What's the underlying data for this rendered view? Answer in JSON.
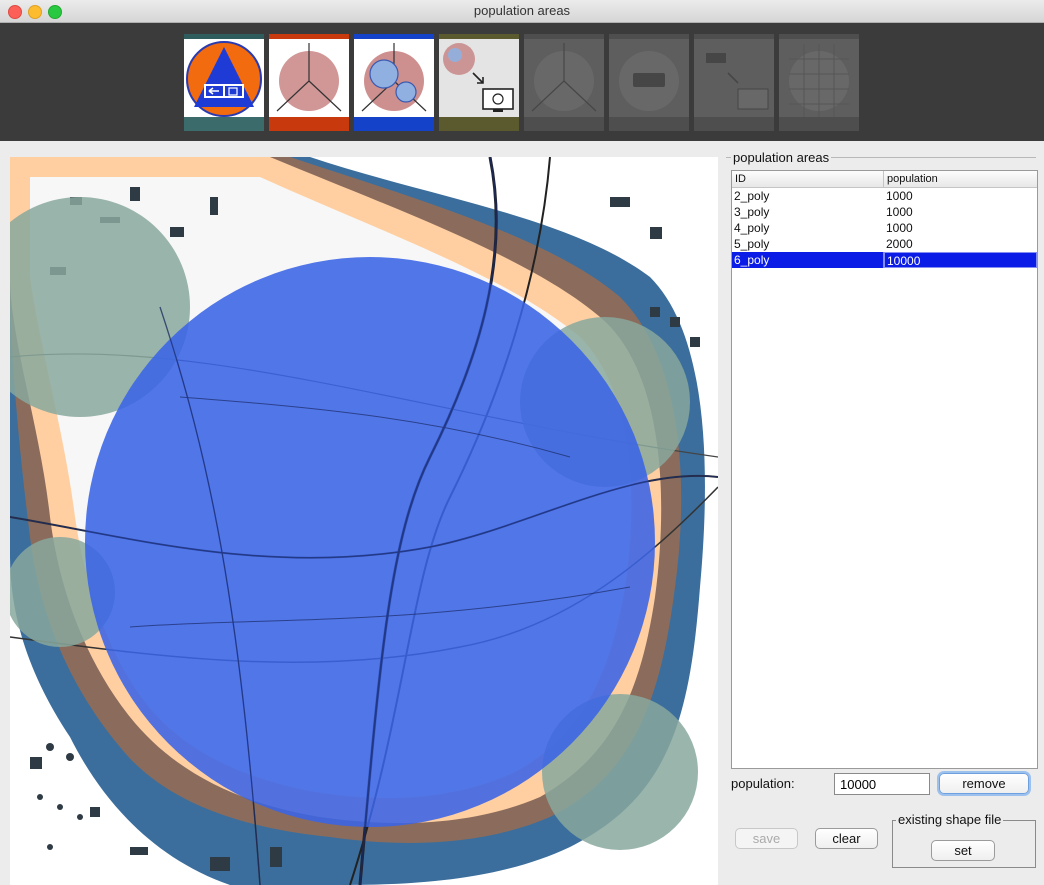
{
  "window": {
    "title": "population areas"
  },
  "toolbar": {
    "tools": [
      {
        "name": "evacuation-tool",
        "bar_top": "#2f5d5d",
        "bar_bottom": "#3b6b6a",
        "enabled": true,
        "selected": true
      },
      {
        "name": "population-tool",
        "bar_top": "#c83a0e",
        "bar_bottom": "#c83a0e",
        "enabled": true
      },
      {
        "name": "overlap-tool",
        "bar_top": "#1442c8",
        "bar_bottom": "#1442c8",
        "enabled": true
      },
      {
        "name": "export-tool",
        "bar_top": "#5a5a2e",
        "bar_bottom": "#5a5a2e",
        "enabled": true
      },
      {
        "name": "network-tool",
        "enabled": false
      },
      {
        "name": "bus-tool",
        "enabled": false
      },
      {
        "name": "bus-export-tool",
        "enabled": false
      },
      {
        "name": "grid-tool",
        "enabled": false
      }
    ]
  },
  "panel": {
    "group_title": "population areas",
    "table": {
      "columns": [
        "ID",
        "population"
      ],
      "rows": [
        {
          "id": "2_poly",
          "population": "1000"
        },
        {
          "id": "3_poly",
          "population": "1000"
        },
        {
          "id": "4_poly",
          "population": "1000"
        },
        {
          "id": "5_poly",
          "population": "2000"
        },
        {
          "id": "6_poly",
          "population": "10000",
          "selected": true
        }
      ]
    },
    "population_label": "population:",
    "population_value": "10000",
    "remove_label": "remove",
    "save_label": "save",
    "clear_label": "clear",
    "shape_group_title": "existing shape file",
    "set_label": "set"
  },
  "colors": {
    "selection": "#0a1ce6",
    "area_circle": "#3a64e6",
    "green_area": "#88a89e",
    "land": "#ffcfa2",
    "water": "#3b6e9c"
  }
}
